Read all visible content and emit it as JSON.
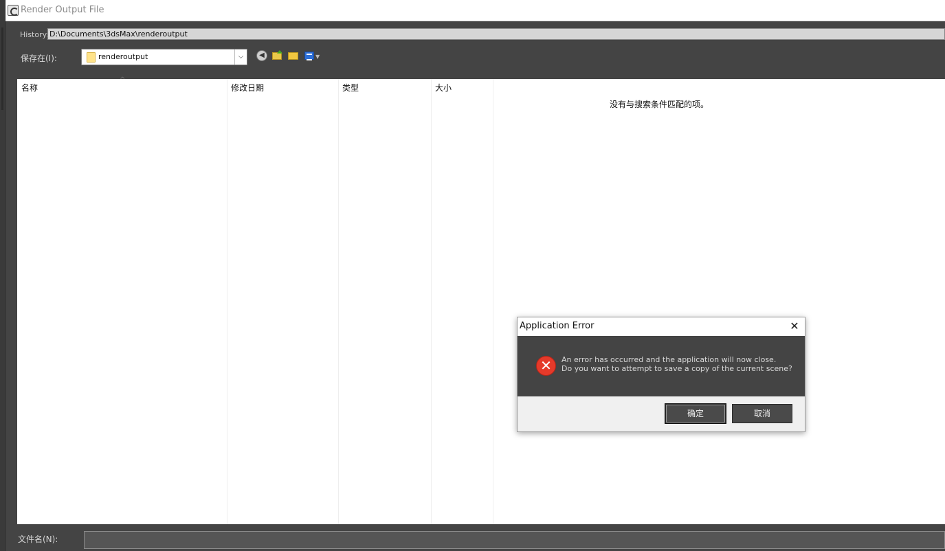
{
  "window": {
    "title": "Render Output File"
  },
  "history": {
    "label": "History:",
    "value": "D:\\Documents\\3dsMax\\renderoutput"
  },
  "save_in": {
    "label": "保存在(I):",
    "value": "renderoutput"
  },
  "file_list": {
    "columns": [
      "名称",
      "修改日期",
      "类型",
      "大小"
    ],
    "empty_message": "没有与搜索条件匹配的项。"
  },
  "filename": {
    "label": "文件名(N):",
    "value": ""
  },
  "dialog": {
    "title": "Application Error",
    "close_glyph": "✕",
    "message_line1": "An error has occurred and the application will now close.",
    "message_line2": "Do you want to attempt to save a copy of the current scene?",
    "ok_label": "确定",
    "cancel_label": "取消"
  },
  "icons": {
    "app": "3ds-max-icon",
    "back": "back-icon",
    "up": "up-folder-icon",
    "new_folder": "new-folder-icon",
    "view_menu": "view-menu-icon",
    "error": "error-icon"
  },
  "colors": {
    "error": "#e53a2a",
    "folder": "#ffe38a",
    "view": "#2d6fd8"
  }
}
